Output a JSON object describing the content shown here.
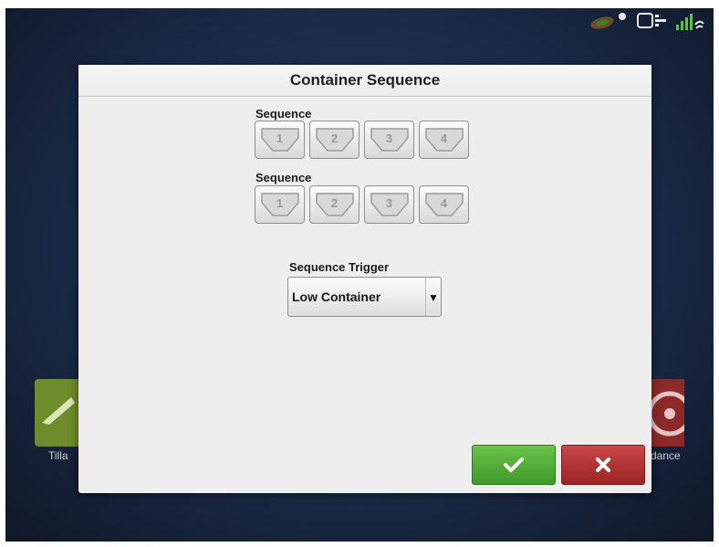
{
  "background": {
    "left_tile_label": "Tilla",
    "right_tile_label": "dance"
  },
  "status_icons": [
    "implement-icon",
    "display-icon",
    "gps-signal-icon"
  ],
  "dialog": {
    "title": "Container Sequence",
    "sequence_groups": [
      {
        "label": "Sequence",
        "containers": [
          "1",
          "2",
          "3",
          "4"
        ]
      },
      {
        "label": "Sequence",
        "containers": [
          "1",
          "2",
          "3",
          "4"
        ]
      }
    ],
    "trigger": {
      "label": "Sequence Trigger",
      "value": "Low Container"
    },
    "ok_icon": "checkmark-icon",
    "cancel_icon": "close-icon"
  },
  "colors": {
    "ok": "#4fae35",
    "cancel": "#b53434",
    "background": "#1b2a47"
  }
}
